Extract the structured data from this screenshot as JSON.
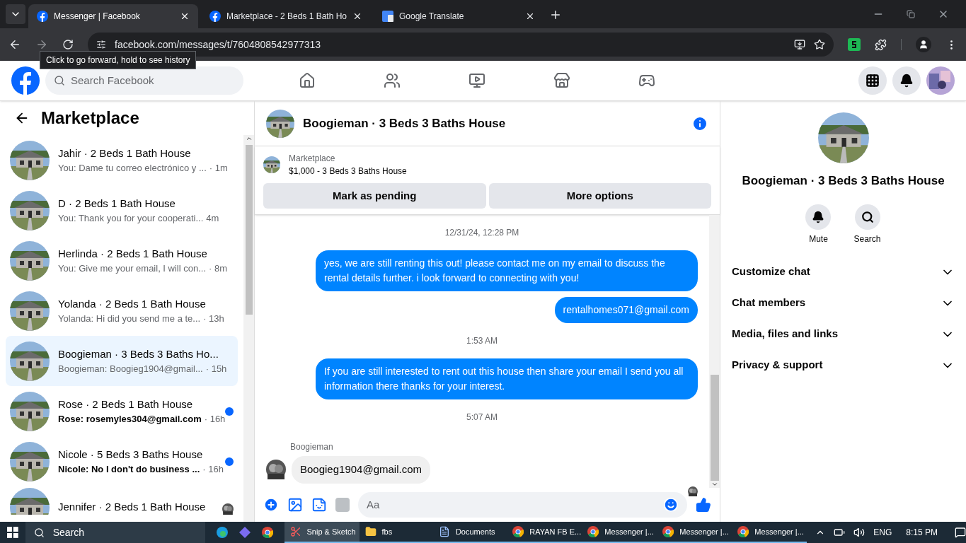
{
  "browser": {
    "tabs": [
      {
        "title": "Messenger | Facebook",
        "kind": "facebook",
        "selected": true
      },
      {
        "title": "Marketplace - 2 Beds 1 Bath Ho",
        "kind": "facebook",
        "selected": false
      },
      {
        "title": "Google Translate",
        "kind": "translate",
        "selected": false
      }
    ],
    "address": "facebook.com/messages/t/7604808542977313",
    "tooltip": "Click to go forward, hold to see history"
  },
  "header": {
    "search_placeholder": "Search Facebook"
  },
  "sidebar": {
    "title": "Marketplace",
    "conversations": [
      {
        "name": "Jahir · 2 Beds 1 Bath House",
        "preview": "You: Dame tu correo electrónico y ...",
        "time": "· 1m",
        "selected": false,
        "unread": false,
        "seen": false
      },
      {
        "name": "D · 2 Beds 1 Bath House",
        "preview": "You: Thank you for your cooperati...",
        "time": "4m",
        "selected": false,
        "unread": false,
        "seen": false
      },
      {
        "name": "Herlinda · 2 Beds 1 Bath House",
        "preview": "You: Give me your email, I will con...",
        "time": "· 8m",
        "selected": false,
        "unread": false,
        "seen": false
      },
      {
        "name": "Yolanda · 2 Beds 1 Bath House",
        "preview": "Yolanda: Hi did you send me a te...",
        "time": "· 13h",
        "selected": false,
        "unread": false,
        "seen": false
      },
      {
        "name": "Boogieman · 3 Beds 3 Baths Ho...",
        "preview": "Boogieman: Boogieg1904@gmail...",
        "time": "· 15h",
        "selected": true,
        "unread": false,
        "seen": false
      },
      {
        "name": "Rose · 2 Beds 1 Bath House",
        "preview": "Rose: rosemyles304@gmail.com",
        "time": "· 16h",
        "selected": false,
        "unread": true,
        "seen": false
      },
      {
        "name": "Nicole · 5 Beds 3 Baths House",
        "preview": "Nicole: No I don't do business ...",
        "time": "· 16h",
        "selected": false,
        "unread": true,
        "seen": false
      },
      {
        "name": "Jennifer · 2 Beds 1 Bath House",
        "selected": false,
        "unread": false,
        "seen": true
      }
    ]
  },
  "chat": {
    "title": "Boogieman · 3 Beds 3 Baths House",
    "listing": {
      "label": "Marketplace",
      "title": "$1,000 - 3 Beds 3 Baths House"
    },
    "actions": [
      "Mark as pending",
      "More options"
    ],
    "messages": [
      {
        "kind": "timestamp",
        "text": "12/31/24, 12:28 PM"
      },
      {
        "kind": "outgoing",
        "text": "yes, we are still renting this out! please contact me on my email to discuss the rental details further. i look forward to connecting with you!"
      },
      {
        "kind": "outgoing",
        "text": "rentalhomes071@gmail.com"
      },
      {
        "kind": "timestamp",
        "text": "1:53 AM"
      },
      {
        "kind": "outgoing",
        "text": "If you are still interested to rent out this house then share your email  I send you all information there thanks for your interest."
      },
      {
        "kind": "timestamp",
        "text": "5:07 AM"
      },
      {
        "kind": "incoming",
        "sender": "Boogieman",
        "text": "Boogieg1904@gmail.com"
      }
    ],
    "composer_placeholder": "Aa"
  },
  "details": {
    "title": "Boogieman · 3 Beds 3 Baths House",
    "actions": [
      {
        "label": "Mute",
        "kind": "mute"
      },
      {
        "label": "Search",
        "kind": "search"
      }
    ],
    "sections": [
      "Customize chat",
      "Chat members",
      "Media, files and links",
      "Privacy & support"
    ]
  },
  "taskbar": {
    "search_placeholder": "Search",
    "apps": [
      {
        "label": "Snip & Sketch",
        "kind": "snip",
        "selected": true
      },
      {
        "label": "fbs",
        "kind": "folder",
        "selected": false
      },
      {
        "label": "Documents",
        "kind": "document",
        "selected": false
      },
      {
        "label": "RAYAN FB E...",
        "kind": "browser",
        "selected": false
      },
      {
        "label": "Messenger |...",
        "kind": "browser",
        "selected": false
      },
      {
        "label": "Messenger |...",
        "kind": "browser",
        "selected": false
      },
      {
        "label": "Messenger |...",
        "kind": "browser",
        "selected": false
      }
    ],
    "language": "ENG",
    "time": "8:15 PM"
  }
}
